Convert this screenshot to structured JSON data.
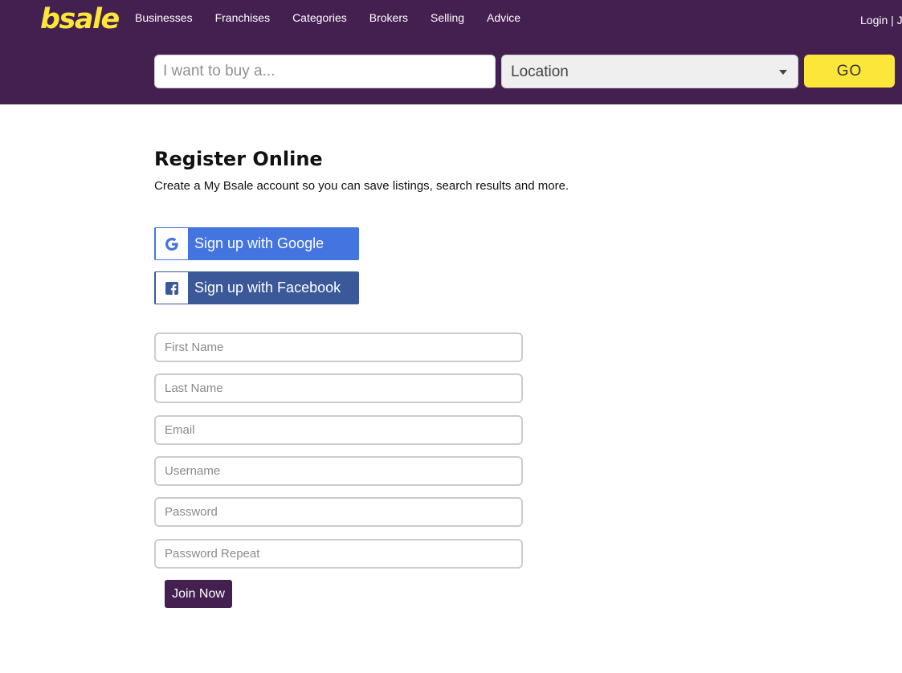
{
  "brand": {
    "logo_text": "bsale",
    "logo_color": "#fde63a",
    "header_bg": "#43204f"
  },
  "nav": {
    "items": [
      {
        "label": "Businesses"
      },
      {
        "label": "Franchises"
      },
      {
        "label": "Categories"
      },
      {
        "label": "Brokers"
      },
      {
        "label": "Selling"
      },
      {
        "label": "Advice"
      }
    ],
    "login_text": "Login | J"
  },
  "search": {
    "placeholder": "I want to buy a...",
    "location_value": "Location",
    "go_label": "GO"
  },
  "main": {
    "title": "Register Online",
    "subtitle": "Create a My Bsale account so you can save listings, search results and more."
  },
  "social": {
    "google_label": "Sign up with Google",
    "google_icon": "google-g-icon",
    "google_color": "#4374e0",
    "facebook_label": "Sign up with Facebook",
    "facebook_icon": "facebook-f-icon",
    "facebook_color": "#3b5998"
  },
  "form": {
    "first_name_placeholder": "First Name",
    "last_name_placeholder": "Last Name",
    "email_placeholder": "Email",
    "username_placeholder": "Username",
    "password_placeholder": "Password",
    "password_repeat_placeholder": "Password Repeat",
    "join_label": "Join Now"
  }
}
